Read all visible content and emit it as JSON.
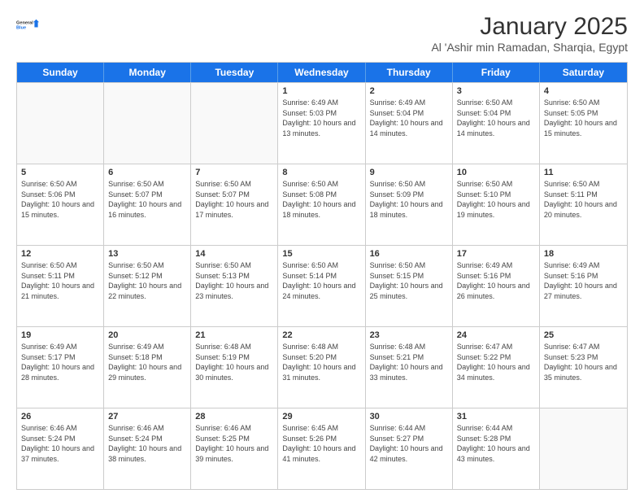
{
  "header": {
    "logo_line1": "General",
    "logo_line2": "Blue",
    "title": "January 2025",
    "subtitle": "Al 'Ashir min Ramadan, Sharqia, Egypt"
  },
  "weekdays": [
    "Sunday",
    "Monday",
    "Tuesday",
    "Wednesday",
    "Thursday",
    "Friday",
    "Saturday"
  ],
  "weeks": [
    [
      {
        "day": "",
        "empty": true
      },
      {
        "day": "",
        "empty": true
      },
      {
        "day": "",
        "empty": true
      },
      {
        "day": "1",
        "sunrise": "6:49 AM",
        "sunset": "5:03 PM",
        "daylight": "10 hours and 13 minutes."
      },
      {
        "day": "2",
        "sunrise": "6:49 AM",
        "sunset": "5:04 PM",
        "daylight": "10 hours and 14 minutes."
      },
      {
        "day": "3",
        "sunrise": "6:50 AM",
        "sunset": "5:04 PM",
        "daylight": "10 hours and 14 minutes."
      },
      {
        "day": "4",
        "sunrise": "6:50 AM",
        "sunset": "5:05 PM",
        "daylight": "10 hours and 15 minutes."
      }
    ],
    [
      {
        "day": "5",
        "sunrise": "6:50 AM",
        "sunset": "5:06 PM",
        "daylight": "10 hours and 15 minutes."
      },
      {
        "day": "6",
        "sunrise": "6:50 AM",
        "sunset": "5:07 PM",
        "daylight": "10 hours and 16 minutes."
      },
      {
        "day": "7",
        "sunrise": "6:50 AM",
        "sunset": "5:07 PM",
        "daylight": "10 hours and 17 minutes."
      },
      {
        "day": "8",
        "sunrise": "6:50 AM",
        "sunset": "5:08 PM",
        "daylight": "10 hours and 18 minutes."
      },
      {
        "day": "9",
        "sunrise": "6:50 AM",
        "sunset": "5:09 PM",
        "daylight": "10 hours and 18 minutes."
      },
      {
        "day": "10",
        "sunrise": "6:50 AM",
        "sunset": "5:10 PM",
        "daylight": "10 hours and 19 minutes."
      },
      {
        "day": "11",
        "sunrise": "6:50 AM",
        "sunset": "5:11 PM",
        "daylight": "10 hours and 20 minutes."
      }
    ],
    [
      {
        "day": "12",
        "sunrise": "6:50 AM",
        "sunset": "5:11 PM",
        "daylight": "10 hours and 21 minutes."
      },
      {
        "day": "13",
        "sunrise": "6:50 AM",
        "sunset": "5:12 PM",
        "daylight": "10 hours and 22 minutes."
      },
      {
        "day": "14",
        "sunrise": "6:50 AM",
        "sunset": "5:13 PM",
        "daylight": "10 hours and 23 minutes."
      },
      {
        "day": "15",
        "sunrise": "6:50 AM",
        "sunset": "5:14 PM",
        "daylight": "10 hours and 24 minutes."
      },
      {
        "day": "16",
        "sunrise": "6:50 AM",
        "sunset": "5:15 PM",
        "daylight": "10 hours and 25 minutes."
      },
      {
        "day": "17",
        "sunrise": "6:49 AM",
        "sunset": "5:16 PM",
        "daylight": "10 hours and 26 minutes."
      },
      {
        "day": "18",
        "sunrise": "6:49 AM",
        "sunset": "5:16 PM",
        "daylight": "10 hours and 27 minutes."
      }
    ],
    [
      {
        "day": "19",
        "sunrise": "6:49 AM",
        "sunset": "5:17 PM",
        "daylight": "10 hours and 28 minutes."
      },
      {
        "day": "20",
        "sunrise": "6:49 AM",
        "sunset": "5:18 PM",
        "daylight": "10 hours and 29 minutes."
      },
      {
        "day": "21",
        "sunrise": "6:48 AM",
        "sunset": "5:19 PM",
        "daylight": "10 hours and 30 minutes."
      },
      {
        "day": "22",
        "sunrise": "6:48 AM",
        "sunset": "5:20 PM",
        "daylight": "10 hours and 31 minutes."
      },
      {
        "day": "23",
        "sunrise": "6:48 AM",
        "sunset": "5:21 PM",
        "daylight": "10 hours and 33 minutes."
      },
      {
        "day": "24",
        "sunrise": "6:47 AM",
        "sunset": "5:22 PM",
        "daylight": "10 hours and 34 minutes."
      },
      {
        "day": "25",
        "sunrise": "6:47 AM",
        "sunset": "5:23 PM",
        "daylight": "10 hours and 35 minutes."
      }
    ],
    [
      {
        "day": "26",
        "sunrise": "6:46 AM",
        "sunset": "5:24 PM",
        "daylight": "10 hours and 37 minutes."
      },
      {
        "day": "27",
        "sunrise": "6:46 AM",
        "sunset": "5:24 PM",
        "daylight": "10 hours and 38 minutes."
      },
      {
        "day": "28",
        "sunrise": "6:46 AM",
        "sunset": "5:25 PM",
        "daylight": "10 hours and 39 minutes."
      },
      {
        "day": "29",
        "sunrise": "6:45 AM",
        "sunset": "5:26 PM",
        "daylight": "10 hours and 41 minutes."
      },
      {
        "day": "30",
        "sunrise": "6:44 AM",
        "sunset": "5:27 PM",
        "daylight": "10 hours and 42 minutes."
      },
      {
        "day": "31",
        "sunrise": "6:44 AM",
        "sunset": "5:28 PM",
        "daylight": "10 hours and 43 minutes."
      },
      {
        "day": "",
        "empty": true
      }
    ]
  ]
}
